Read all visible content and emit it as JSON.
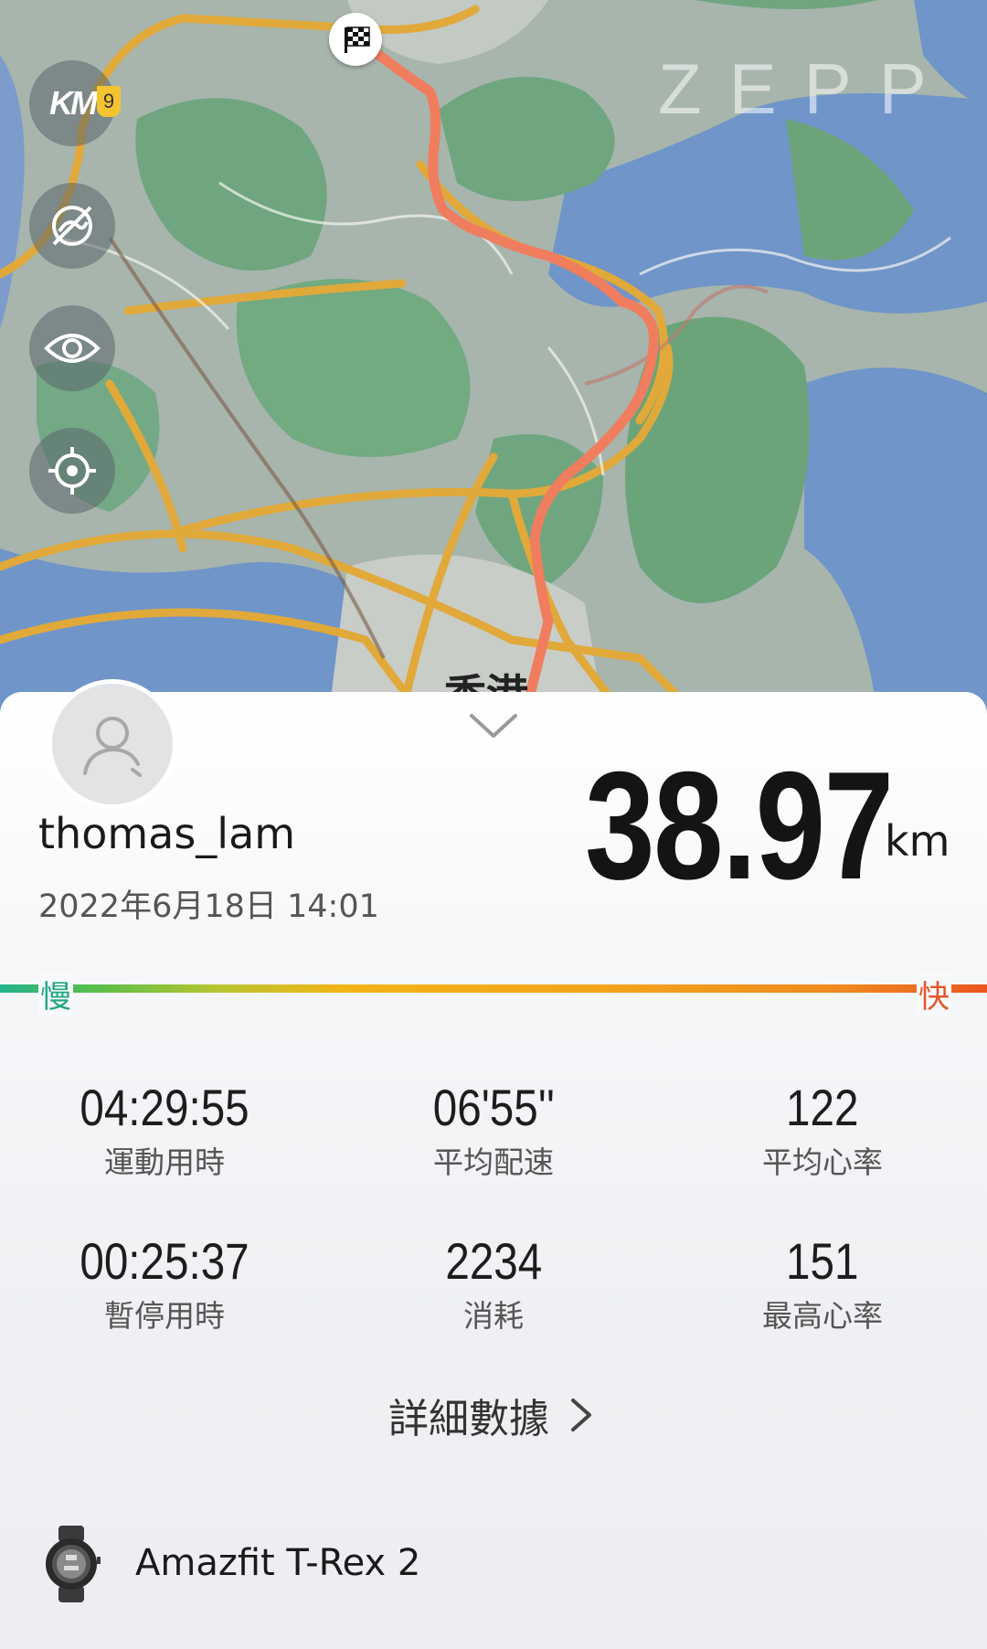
{
  "map": {
    "brand_logo": "ZEPP",
    "place_label": "香港",
    "controls": {
      "km_markers": {
        "icon": "km-markers-icon",
        "text": "KM",
        "badge": "9"
      },
      "toggle_route": {
        "icon": "route-hidden-icon"
      },
      "view": {
        "icon": "eye-icon"
      },
      "locate": {
        "icon": "locate-icon"
      }
    },
    "finish_marker": {
      "icon": "checkered-flag-icon"
    },
    "colors": {
      "land": "#9fb0a4",
      "water": "#6c93c9",
      "green": "#6fa67f",
      "road": "#e0a93a",
      "route": "#f08060"
    }
  },
  "summary": {
    "username": "thomas_lam",
    "datetime": "2022年6月18日 14:01",
    "distance": "38.97",
    "distance_unit": "km",
    "pace_scale": {
      "slow": "慢",
      "fast": "快"
    }
  },
  "stats": [
    {
      "value": "04:29:55",
      "label": "運動用時"
    },
    {
      "value": "06'55''",
      "label": "平均配速"
    },
    {
      "value": "122",
      "label": "平均心率"
    },
    {
      "value": "00:25:37",
      "label": "暫停用時"
    },
    {
      "value": "2234",
      "label": "消耗"
    },
    {
      "value": "151",
      "label": "最高心率"
    }
  ],
  "details_link": {
    "label": "詳細數據"
  },
  "device": {
    "name": "Amazfit T-Rex 2"
  }
}
